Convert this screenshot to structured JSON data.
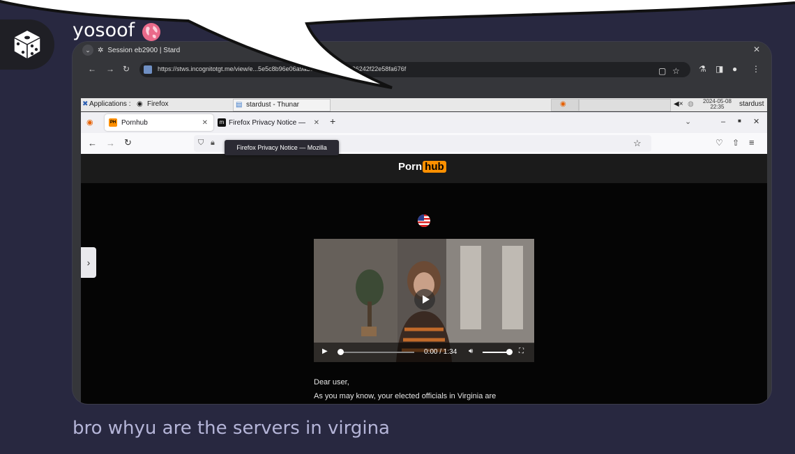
{
  "user": {
    "name": "yosoof",
    "message": "bro whyu are the servers in virgina"
  },
  "chrome": {
    "tab_title": "Session eb2900 | Stard",
    "url": "https://stws.incognitotgt.me/view/e...5e5c8b96e06a9a38e7d98992e6186242f22e58fa676f"
  },
  "xfce_panel": {
    "applications": "Applications :",
    "firefox": "Firefox",
    "thunar": "stardust - Thunar",
    "date": "2024-05-08",
    "time": "22:35",
    "user": "stardust"
  },
  "firefox": {
    "tabs": [
      {
        "label": "Pornhub",
        "favicon": "PH"
      },
      {
        "label": "Firefox Privacy Notice —",
        "favicon": "m"
      }
    ],
    "tooltip": "Firefox Privacy Notice — Mozilla"
  },
  "page": {
    "logo_left": "Porn",
    "logo_right": "hub",
    "video_time": "0:00 / 1:34",
    "greeting": "Dear user,",
    "paragraph_start": "As you may know, your elected officials in Virginia are"
  },
  "colors": {
    "background": "#282840",
    "brand_orange": "#ff9000"
  }
}
